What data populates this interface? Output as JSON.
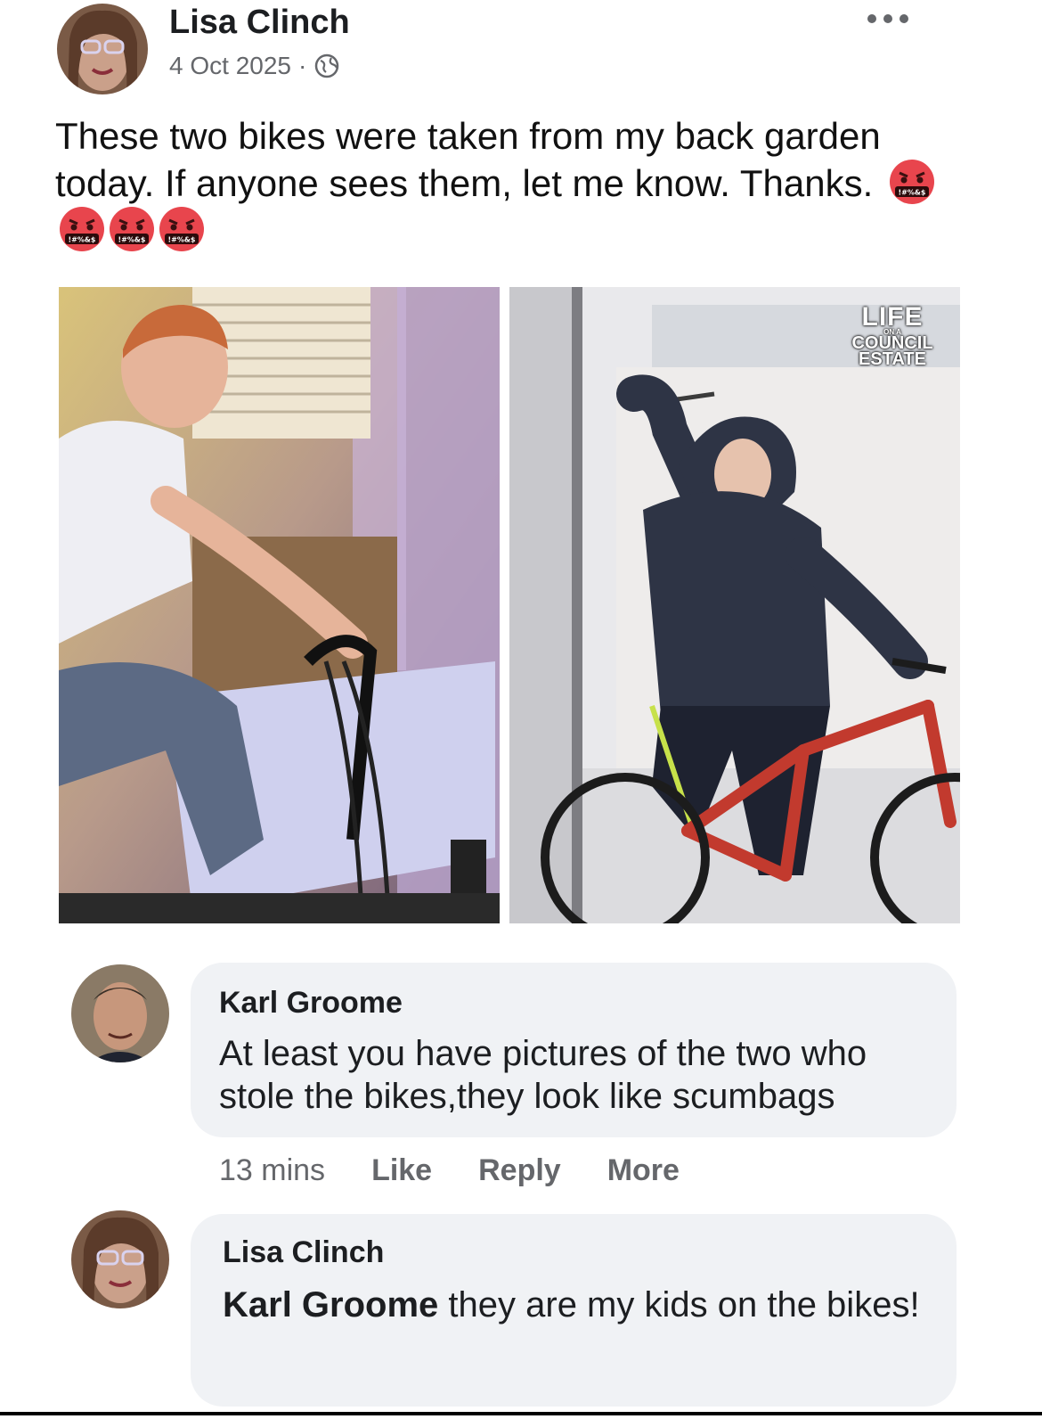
{
  "post": {
    "author": "Lisa Clinch",
    "date": "4 Oct 2025",
    "separator": "·",
    "privacy_icon": "globe-icon",
    "menu_icon": "more-options-icon",
    "text": "These two bikes were taken from my back garden today. If anyone sees them, let me know. Thanks.",
    "emoji_name": "face-with-symbols-on-mouth",
    "emoji_count": 4,
    "emoji_text": "!#%&$",
    "watermark": {
      "line1": "LIFE",
      "line2": "ON A",
      "line3": "COUNCIL",
      "line4": "ESTATE"
    }
  },
  "comments": [
    {
      "author": "Karl Groome",
      "text": "At least you have pictures of the two who stole the bikes,they look like scumbags",
      "time": "13 mins",
      "actions": [
        "Like",
        "Reply",
        "More"
      ]
    },
    {
      "author": "Lisa Clinch",
      "mention": "Karl Groome",
      "text": " they are my kids on the bikes!"
    }
  ],
  "colors": {
    "bubble": "#f0f2f5",
    "secondary_text": "#65676b",
    "emoji_face": "#e8454d"
  }
}
